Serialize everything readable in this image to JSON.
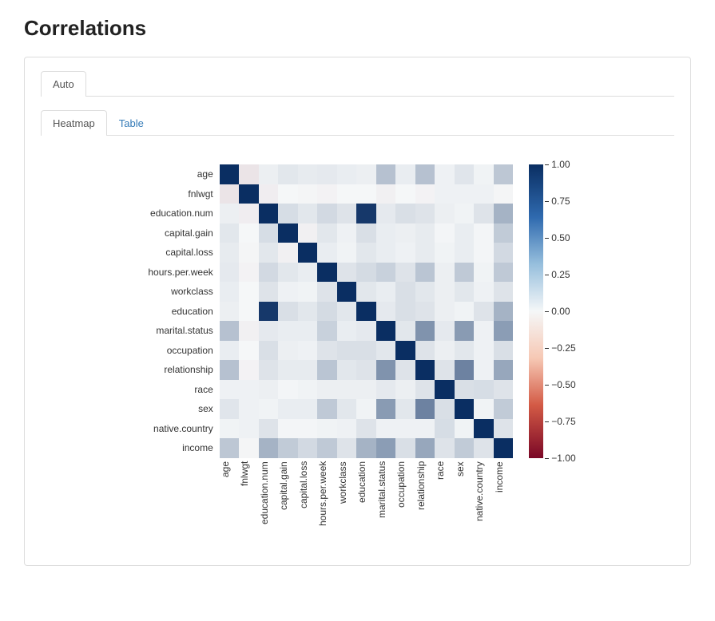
{
  "page": {
    "title": "Correlations"
  },
  "tabs_outer": [
    {
      "label": "Auto",
      "active": true
    }
  ],
  "tabs_inner": [
    {
      "label": "Heatmap",
      "active": true
    },
    {
      "label": "Table",
      "active": false
    }
  ],
  "colorbar": {
    "ticks": [
      {
        "label": "1.00",
        "value": 1.0
      },
      {
        "label": "0.75",
        "value": 0.75
      },
      {
        "label": "0.50",
        "value": 0.5
      },
      {
        "label": "0.25",
        "value": 0.25
      },
      {
        "label": "0.00",
        "value": 0.0
      },
      {
        "label": "−0.25",
        "value": -0.25
      },
      {
        "label": "−0.50",
        "value": -0.5
      },
      {
        "label": "−0.75",
        "value": -0.75
      },
      {
        "label": "−1.00",
        "value": -1.0
      }
    ]
  },
  "chart_data": {
    "type": "heatmap",
    "vmin": -1.0,
    "vmax": 1.0,
    "cmap": "coolwarm_r",
    "labels": [
      "age",
      "fnlwgt",
      "education.num",
      "capital.gain",
      "capital.loss",
      "hours.per.week",
      "workclass",
      "education",
      "marital.status",
      "occupation",
      "relationship",
      "race",
      "sex",
      "native.country",
      "income"
    ],
    "matrix": [
      [
        1.0,
        -0.08,
        0.04,
        0.08,
        0.06,
        0.07,
        0.05,
        0.04,
        0.27,
        0.05,
        0.27,
        0.03,
        0.09,
        0.02,
        0.24
      ],
      [
        -0.08,
        1.0,
        -0.04,
        0.0,
        -0.01,
        -0.02,
        0.0,
        0.0,
        -0.03,
        0.0,
        -0.02,
        0.03,
        0.03,
        0.03,
        -0.01
      ],
      [
        0.04,
        -0.04,
        1.0,
        0.13,
        0.08,
        0.15,
        0.1,
        0.95,
        0.07,
        0.12,
        0.1,
        0.04,
        0.02,
        0.1,
        0.34
      ],
      [
        0.08,
        0.0,
        0.13,
        1.0,
        -0.03,
        0.08,
        0.03,
        0.12,
        0.05,
        0.04,
        0.06,
        0.01,
        0.05,
        0.01,
        0.22
      ],
      [
        0.06,
        -0.01,
        0.08,
        -0.03,
        1.0,
        0.05,
        0.02,
        0.08,
        0.05,
        0.03,
        0.06,
        0.02,
        0.05,
        0.01,
        0.15
      ],
      [
        0.07,
        -0.02,
        0.15,
        0.08,
        0.05,
        1.0,
        0.1,
        0.14,
        0.19,
        0.1,
        0.25,
        0.04,
        0.23,
        0.02,
        0.23
      ],
      [
        0.05,
        0.0,
        0.1,
        0.03,
        0.02,
        0.1,
        1.0,
        0.08,
        0.05,
        0.12,
        0.08,
        0.04,
        0.08,
        0.03,
        0.1
      ],
      [
        0.04,
        0.0,
        0.95,
        0.12,
        0.08,
        0.14,
        0.08,
        1.0,
        0.07,
        0.12,
        0.1,
        0.04,
        0.02,
        0.1,
        0.34
      ],
      [
        0.27,
        -0.03,
        0.07,
        0.05,
        0.05,
        0.19,
        0.05,
        0.07,
        1.0,
        0.08,
        0.5,
        0.07,
        0.46,
        0.03,
        0.45
      ],
      [
        0.05,
        0.0,
        0.12,
        0.04,
        0.03,
        0.1,
        0.12,
        0.12,
        0.08,
        1.0,
        0.1,
        0.04,
        0.08,
        0.03,
        0.12
      ],
      [
        0.27,
        -0.02,
        0.1,
        0.06,
        0.06,
        0.25,
        0.08,
        0.1,
        0.5,
        0.1,
        1.0,
        0.1,
        0.58,
        0.03,
        0.4
      ],
      [
        0.03,
        0.03,
        0.04,
        0.01,
        0.02,
        0.04,
        0.04,
        0.04,
        0.07,
        0.04,
        0.1,
        1.0,
        0.12,
        0.13,
        0.1
      ],
      [
        0.09,
        0.03,
        0.02,
        0.05,
        0.05,
        0.23,
        0.08,
        0.02,
        0.46,
        0.08,
        0.58,
        0.12,
        1.0,
        0.02,
        0.22
      ],
      [
        0.02,
        0.03,
        0.1,
        0.01,
        0.01,
        0.02,
        0.03,
        0.1,
        0.03,
        0.03,
        0.03,
        0.13,
        0.02,
        1.0,
        0.1
      ],
      [
        0.24,
        -0.01,
        0.34,
        0.22,
        0.15,
        0.23,
        0.1,
        0.34,
        0.45,
        0.12,
        0.4,
        0.1,
        0.22,
        0.1,
        1.0
      ]
    ]
  }
}
